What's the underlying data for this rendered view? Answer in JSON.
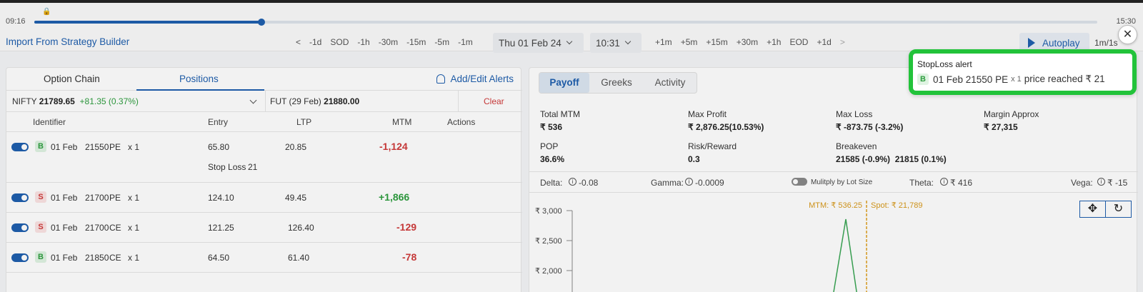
{
  "timeline": {
    "start": "09:16",
    "end": "15:30",
    "progress": 0.214
  },
  "toolbar": {
    "import_label": "Import From Strategy Builder",
    "steps_back": [
      "<",
      "-1d",
      "SOD",
      "-1h",
      "-30m",
      "-15m",
      "-5m",
      "-1m"
    ],
    "date": "Thu  01 Feb 24",
    "time": "10:31",
    "steps_fwd": [
      "+1m",
      "+5m",
      "+15m",
      "+30m",
      "+1h",
      "EOD",
      "+1d",
      ">"
    ],
    "autoplay": "Autoplay",
    "speed": "1m/1s"
  },
  "left": {
    "tabs": [
      "Option Chain",
      "Positions"
    ],
    "alerts": "Add/Edit Alerts",
    "nifty": {
      "name": "NIFTY",
      "price": "21789.65",
      "change": "+81.35 (0.37%)"
    },
    "fut": {
      "name": "FUT (29 Feb)",
      "price": "21880.00"
    },
    "clear": "Clear",
    "headers": [
      "Identifier",
      "Entry",
      "LTP",
      "MTM",
      "Actions"
    ],
    "rows": [
      {
        "side": "B",
        "date": "01 Feb",
        "strike": "21550",
        "type": "PE",
        "qty": "x 1",
        "entry": "65.80",
        "ltp": "20.85",
        "mtm": "-1,124",
        "sl_label": "Stop Loss",
        "sl_value": "21"
      },
      {
        "side": "S",
        "date": "01 Feb",
        "strike": "21700",
        "type": "PE",
        "qty": "x 1",
        "entry": "124.10",
        "ltp": "49.45",
        "mtm": "+1,866"
      },
      {
        "side": "S",
        "date": "01 Feb",
        "strike": "21700",
        "type": "CE",
        "qty": "x 1",
        "entry": "121.25",
        "ltp": "126.40",
        "mtm": "-129"
      },
      {
        "side": "B",
        "date": "01 Feb",
        "strike": "21850",
        "type": "CE",
        "qty": "x 1",
        "entry": "64.50",
        "ltp": "61.40",
        "mtm": "-78"
      }
    ]
  },
  "right": {
    "tabs": [
      "Payoff",
      "Greeks",
      "Activity"
    ],
    "stats": [
      {
        "label": "Total MTM",
        "value": "₹ 536",
        "color": "green"
      },
      {
        "label": "Max Profit",
        "value": "₹ 2,876.25(10.53%)",
        "color": "green"
      },
      {
        "label": "Max Loss",
        "value": "₹ -873.75 (-3.2%)",
        "color": "red"
      },
      {
        "label": "Margin Approx",
        "value": "₹ 27,315",
        "color": "dark"
      },
      {
        "label": "POP",
        "value": "36.6%",
        "color": "dark"
      },
      {
        "label": "Risk/Reward",
        "value": "0.3",
        "color": "dark"
      },
      {
        "label": "Breakeven",
        "value": "21585 (-0.9%)  21815 (0.1%)",
        "color": "dark"
      }
    ],
    "greeks": {
      "delta_label": "Delta:",
      "delta": "-0.08",
      "gamma_label": "Gamma:",
      "gamma": "-0.0009",
      "multiply": "Mulitply by Lot Size",
      "theta_label": "Theta:",
      "theta": "₹ 416",
      "vega_label": "Vega:",
      "vega": "₹ -15"
    },
    "chart": {
      "mtm_label": "MTM: ₹ 536.25",
      "spot_label": "Spot: ₹ 21,789",
      "yticks": [
        "₹ 3,000",
        "₹ 2,500",
        "₹ 2,000"
      ]
    }
  },
  "alert": {
    "title": "StopLoss alert",
    "side": "B",
    "instrument": "01 Feb 21550 PE",
    "qty": "x 1",
    "message": "price reached ₹ 21"
  }
}
